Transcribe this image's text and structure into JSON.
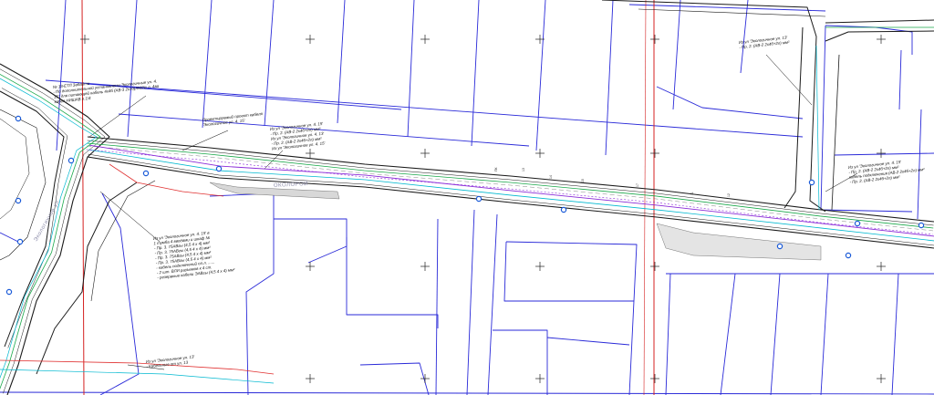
{
  "drawing": {
    "colors": {
      "background": "#ffffff",
      "parcel": "#2a2ad8",
      "grid_vertical": "#d42020",
      "grid_cross": "#222222",
      "road": "#1a1a1a",
      "utility_green": "#1aa84a",
      "utility_cyan": "#00b8d0",
      "utility_purple": "#8a2ad8",
      "utility_red": "#e03030",
      "label": "#111111"
    },
    "annotations": [
      {
        "id": "a1",
        "lines": [
          "№ 13-ЕТЛ Забайти",
          "- По дополнительной установлены  Экологичные ул. 4.",
          "15° для питающей кабель 4х4б (АВ-3 2х10)ЛМ/№ л. 4ва",
          "кабел НИШАВ л.1/4"
        ]
      },
      {
        "id": "a2",
        "lines": [
          "Проектируемый проект кабеля",
          "'Экологичное ул. 4. 15'"
        ]
      },
      {
        "id": "a3",
        "lines": [
          "Из ул 'Экологичное ул. 4. 15'",
          "- Пр. 2. (АВ-2 2х4б+2л) мм²",
          "Из ул 'Экологичное ул. 4. 13'",
          "- Пр. 2. (АВ-2 2х4б+2л) мм²",
          "Из ул 'Экологичное ул. 4. 15'"
        ]
      },
      {
        "id": "a4",
        "lines": [
          "Из ул 'Экологичное ул. 4. 15' в",
          "1 тумба 4 вводами и шкаф №",
          "- Пр. 3. 75АВгы (4,5 4 х 4) мм²",
          "- Пр. 3. 75АВгы (4,5 4 х 4) мм²",
          "- Пр. 3. 75АВгы (4,5 4 х 4) мм²",
          "- Пр. 3. 75АВгы (4,5 4 х 4) мм²",
          "- кабель подключений оп.л. ......",
          "- 2 шт. ВЛИ разъемов к 4 ст.",
          "- резервные кабели ЭАВгы (4,5 4 х 4) мм²"
        ]
      },
      {
        "id": "a5",
        "lines": [
          "Из ул 'Экологичное ул. 13'",
          "- Пр. 2. (АВ-2 2х4б+2л) мм²"
        ]
      },
      {
        "id": "a6",
        "lines": [
          "Из ул 'Экологичное ул. 4. 15'",
          "- Пр. 2. (АВ-2 2х4б+2л) мм²",
          "кабель подключения (АВ-2 2х4б+2л) мм²",
          "- Пр. 2. (АВ-2 2х4б+2л) мм²"
        ]
      },
      {
        "id": "a7",
        "lines": [
          "Из ул 'Экологичное ул. 13'",
          "- Кабельные от ул. 13"
        ]
      }
    ],
    "street_names": [
      "ОКОЛОРОЙ",
      "Экологичное ул."
    ],
    "tick_labels": [
      "ПК",
      "13",
      "14",
      "15",
      "17",
      "11",
      "12"
    ]
  }
}
